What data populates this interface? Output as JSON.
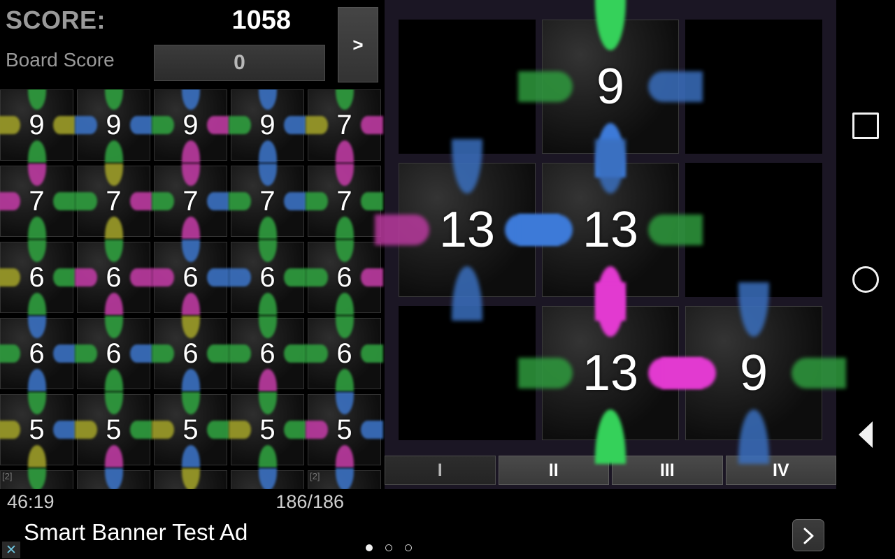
{
  "header": {
    "score_label": "SCORE:",
    "score_value": "1058",
    "board_score_label": "Board Score",
    "board_score_value": "0",
    "next_button_label": ">"
  },
  "status": {
    "timer": "46:19",
    "progress": "186/186"
  },
  "colors": {
    "green": "#2f9b3e",
    "blue": "#3a6fbe",
    "magenta": "#b93a9e",
    "yellow": "#9a9a28",
    "green_bright": "#35d15a",
    "blue_bright": "#3d7ad8",
    "magenta_bright": "#e23ad0",
    "board_bg": "#1b1624",
    "tile_bg": "#141414",
    "accent_close": "#6fc6e0"
  },
  "left_grid": {
    "rows": [
      [
        {
          "value": "9",
          "top": "green",
          "right": "yellow",
          "bottom": "green",
          "left": "yellow"
        },
        {
          "value": "9",
          "top": "green",
          "right": "blue",
          "bottom": "green",
          "left": "blue"
        },
        {
          "value": "9",
          "top": "blue",
          "right": "magenta",
          "bottom": "magenta",
          "left": "green"
        },
        {
          "value": "9",
          "top": "blue",
          "right": "blue",
          "bottom": "blue",
          "left": "green"
        },
        {
          "value": "7",
          "top": "green",
          "right": "magenta",
          "bottom": "magenta",
          "left": "yellow"
        }
      ],
      [
        {
          "value": "7",
          "top": "magenta",
          "right": "green",
          "bottom": "green",
          "left": "magenta"
        },
        {
          "value": "7",
          "top": "yellow",
          "right": "magenta",
          "bottom": "yellow",
          "left": "green"
        },
        {
          "value": "7",
          "top": "magenta",
          "right": "blue",
          "bottom": "magenta",
          "left": "green"
        },
        {
          "value": "7",
          "top": "blue",
          "right": "blue",
          "bottom": "green",
          "left": "green"
        },
        {
          "value": "7",
          "top": "magenta",
          "right": "green",
          "bottom": "green",
          "left": "green"
        }
      ],
      [
        {
          "value": "6",
          "top": "green",
          "right": "green",
          "bottom": "green",
          "left": "yellow"
        },
        {
          "value": "6",
          "top": "green",
          "right": "magenta",
          "bottom": "magenta",
          "left": "magenta"
        },
        {
          "value": "6",
          "top": "blue",
          "right": "blue",
          "bottom": "magenta",
          "left": "magenta"
        },
        {
          "value": "6",
          "top": "green",
          "right": "green",
          "bottom": "green",
          "left": "blue"
        },
        {
          "value": "6",
          "top": "green",
          "right": "magenta",
          "bottom": "green",
          "left": "green"
        }
      ],
      [
        {
          "value": "6",
          "top": "blue",
          "right": "blue",
          "bottom": "blue",
          "left": "green"
        },
        {
          "value": "6",
          "top": "green",
          "right": "blue",
          "bottom": "green",
          "left": "green"
        },
        {
          "value": "6",
          "top": "yellow",
          "right": "green",
          "bottom": "blue",
          "left": "green"
        },
        {
          "value": "6",
          "top": "green",
          "right": "green",
          "bottom": "magenta",
          "left": "green"
        },
        {
          "value": "6",
          "top": "green",
          "right": "green",
          "bottom": "green",
          "left": "green"
        }
      ],
      [
        {
          "value": "5",
          "top": "green",
          "right": "blue",
          "bottom": "yellow",
          "left": "yellow"
        },
        {
          "value": "5",
          "top": "green",
          "right": "green",
          "bottom": "magenta",
          "left": "yellow"
        },
        {
          "value": "5",
          "top": "green",
          "right": "green",
          "bottom": "blue",
          "left": "yellow"
        },
        {
          "value": "5",
          "top": "green",
          "right": "green",
          "bottom": "green",
          "left": "yellow"
        },
        {
          "value": "5",
          "top": "blue",
          "right": "blue",
          "bottom": "magenta",
          "left": "magenta"
        }
      ],
      [
        {
          "value": "",
          "corner": "[2]",
          "top": "green",
          "right": "",
          "bottom": "",
          "left": ""
        },
        {
          "value": "",
          "corner": "",
          "top": "blue",
          "right": "",
          "bottom": "",
          "left": ""
        },
        {
          "value": "",
          "corner": "",
          "top": "yellow",
          "right": "",
          "bottom": "",
          "left": ""
        },
        {
          "value": "",
          "corner": "",
          "top": "blue",
          "right": "",
          "bottom": "",
          "left": ""
        },
        {
          "value": "",
          "corner": "[2]",
          "top": "blue",
          "right": "",
          "bottom": "",
          "left": ""
        }
      ]
    ]
  },
  "board": {
    "cells": [
      {
        "filled": false,
        "value": ""
      },
      {
        "filled": true,
        "value": "9",
        "top": "green_bright",
        "right": "blue",
        "bottom": "blue_bright",
        "left": "green"
      },
      {
        "filled": false,
        "value": ""
      },
      {
        "filled": true,
        "value": "13",
        "top": "blue",
        "right": "blue_bright",
        "bottom": "blue",
        "left": "magenta"
      },
      {
        "filled": true,
        "value": "13",
        "top": "blue",
        "right": "green",
        "bottom": "magenta_bright",
        "left": "blue_bright"
      },
      {
        "filled": false,
        "value": ""
      },
      {
        "filled": false,
        "value": ""
      },
      {
        "filled": true,
        "value": "13",
        "top": "magenta_bright",
        "right": "magenta_bright",
        "bottom": "green_bright",
        "left": "green"
      },
      {
        "filled": true,
        "value": "9",
        "top": "blue",
        "right": "green",
        "bottom": "blue",
        "left": "magenta_bright"
      }
    ]
  },
  "roman_buttons": [
    {
      "label": "I",
      "pressed": true
    },
    {
      "label": "II",
      "pressed": false
    },
    {
      "label": "III",
      "pressed": false
    },
    {
      "label": "IV",
      "pressed": false
    }
  ],
  "navbar": {
    "recents": "recents",
    "home": "home",
    "back": "back"
  },
  "ad": {
    "text": "Smart Banner Test Ad",
    "close_label": "✕",
    "next_label": "next",
    "dots": 3,
    "active_dot": 0
  }
}
